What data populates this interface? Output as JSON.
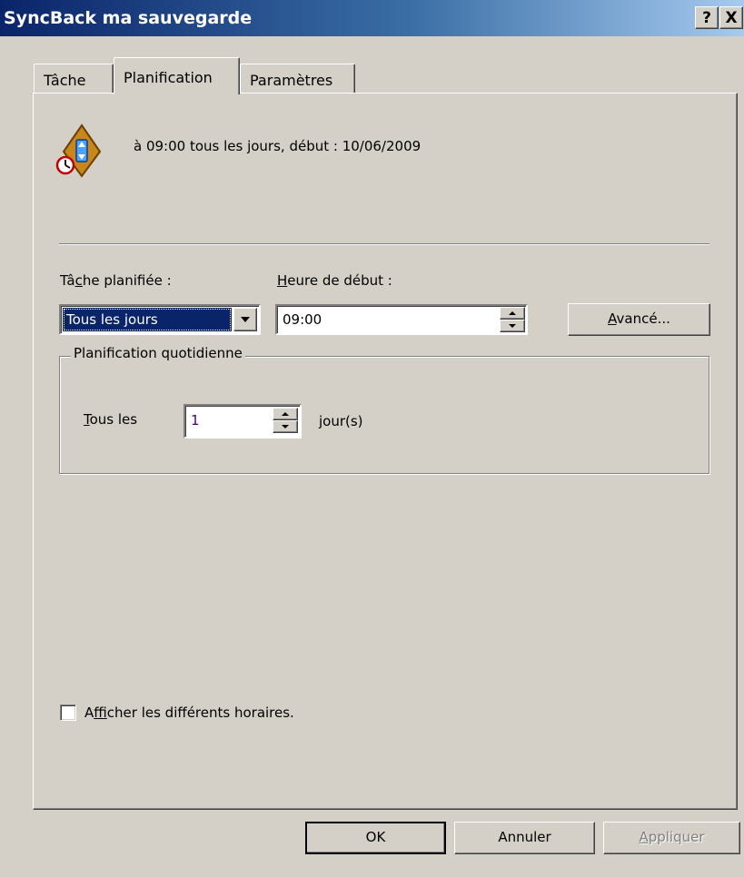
{
  "window": {
    "title": "SyncBack ma sauvegarde",
    "help_label": "?",
    "close_label": "X"
  },
  "tabs": [
    {
      "label": "Tâche",
      "active": false
    },
    {
      "label": "Planification",
      "active": true
    },
    {
      "label": "Paramètres",
      "active": false
    }
  ],
  "schedule": {
    "summary": "à 09:00 tous les jours, début : 10/06/2009",
    "icon": "schedule-clock-icon"
  },
  "task": {
    "label_pre": "Tâ",
    "label_accel": "c",
    "label_post": "he planifiée :",
    "selected": "Tous les jours"
  },
  "start_time": {
    "label_accel": "H",
    "label_post": "eure de début :",
    "value": "09:00"
  },
  "advanced": {
    "label_accel": "A",
    "label_post": "vancé..."
  },
  "daily": {
    "legend": "Planification quotidienne",
    "every_accel": "T",
    "every_post": "ous les",
    "every_value": "1",
    "unit": "jour(s)"
  },
  "show_times": {
    "label_pre": "A",
    "label_accel": "f",
    "label_post": "ficher les différents horaires.",
    "checked": false
  },
  "footer": {
    "ok_label": "OK",
    "cancel_label": "Annuler",
    "apply_accel": "A",
    "apply_post": "ppliquer"
  },
  "colors": {
    "face": "#d4d0c8",
    "title_start": "#0a246a",
    "title_end": "#a6caf0",
    "selection": "#0a246a"
  }
}
